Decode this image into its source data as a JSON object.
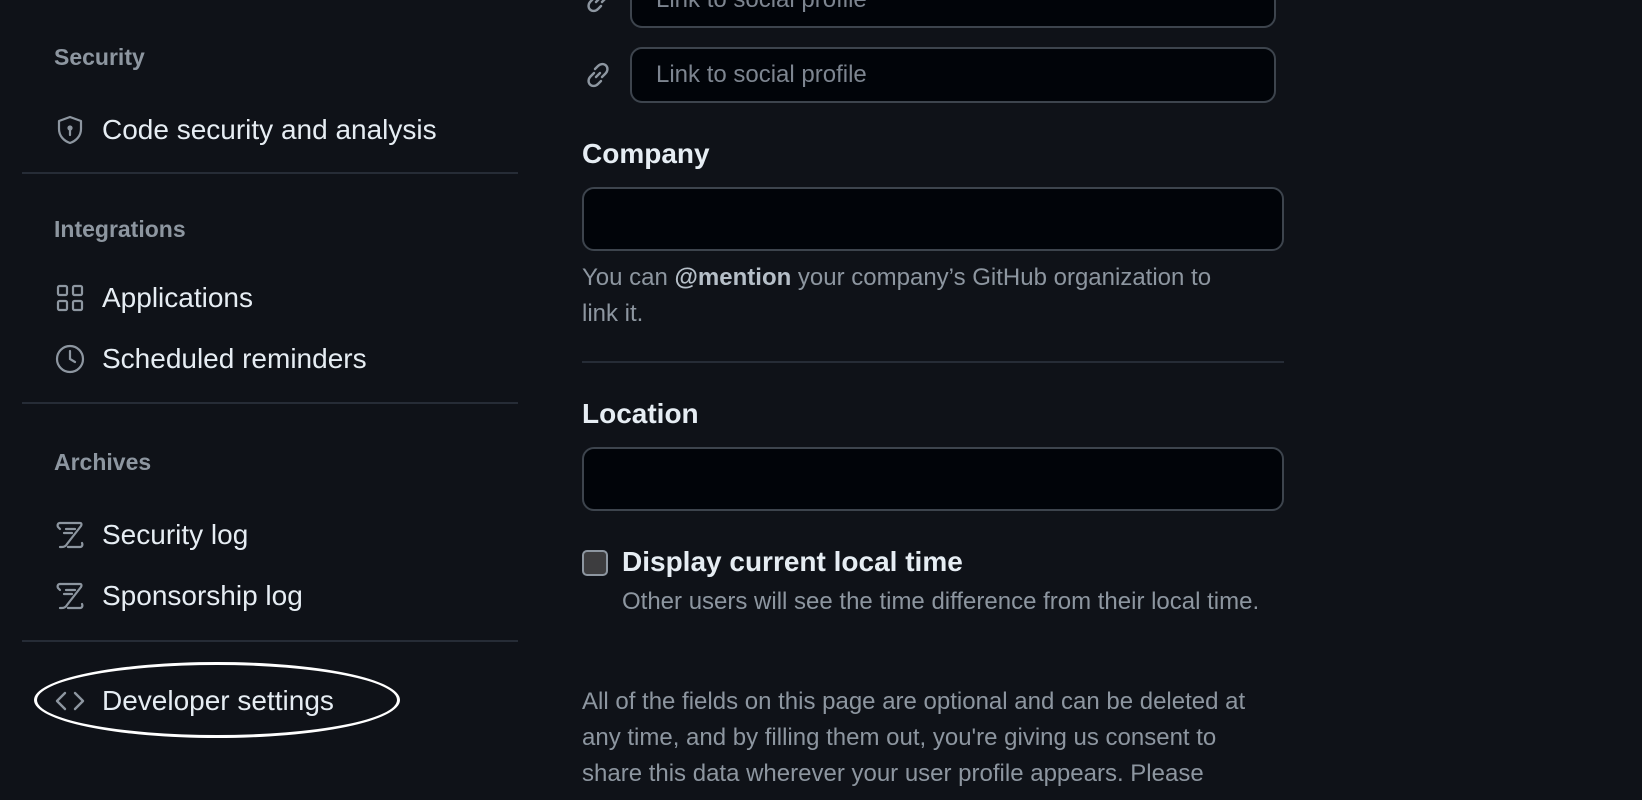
{
  "sidebar": {
    "sections": [
      {
        "heading": "Security",
        "items": [
          {
            "label": "Code security and analysis",
            "icon": "shield-lock-icon"
          }
        ]
      },
      {
        "heading": "Integrations",
        "items": [
          {
            "label": "Applications",
            "icon": "apps-grid-icon"
          },
          {
            "label": "Scheduled reminders",
            "icon": "clock-icon"
          }
        ]
      },
      {
        "heading": "Archives",
        "items": [
          {
            "label": "Security log",
            "icon": "log-icon"
          },
          {
            "label": "Sponsorship log",
            "icon": "log-icon"
          }
        ]
      }
    ],
    "developer_settings": {
      "label": "Developer settings",
      "icon": "code-icon"
    }
  },
  "social": {
    "placeholder": "Link to social profile",
    "icon": "link-icon"
  },
  "company": {
    "label": "Company",
    "value": "",
    "hint_prefix": "You can ",
    "hint_mention": "@mention",
    "hint_suffix": " your company’s GitHub organization to link it."
  },
  "location": {
    "label": "Location",
    "value": ""
  },
  "local_time": {
    "label": "Display current local time",
    "checked": false,
    "hint": "Other users will see the time difference from their local time."
  },
  "footer_note": "All of the fields on this page are optional and can be deleted at any time, and by filling them out, you're giving us consent to share this data wherever your user profile appears. Please",
  "colors": {
    "background": "#0f1218",
    "input_background": "#010409",
    "border": "#3d444d",
    "muted_text": "#8d96a0",
    "primary_text": "#e6edf3"
  }
}
